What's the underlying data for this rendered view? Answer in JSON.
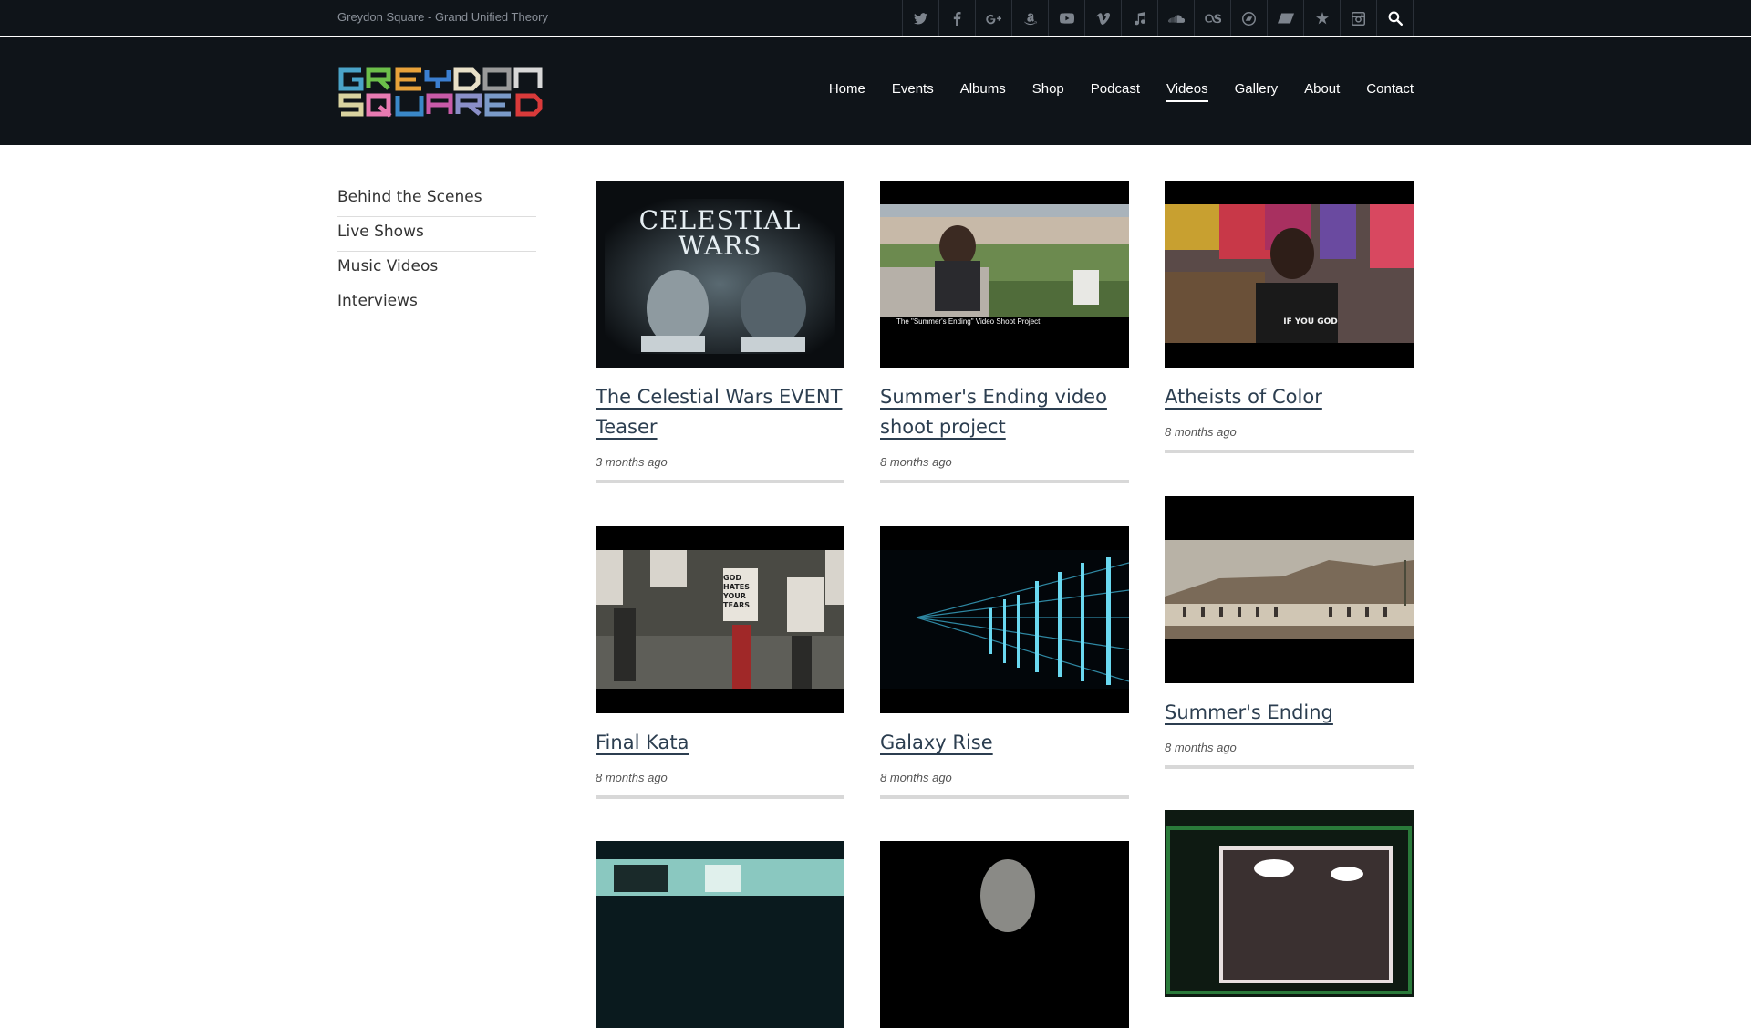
{
  "topbar": {
    "tagline": "Greydon Square - Grand Unified Theory",
    "social_icons": [
      "twitter-icon",
      "facebook-icon",
      "google-plus-icon",
      "amazon-icon",
      "youtube-icon",
      "vimeo-icon",
      "itunes-icon",
      "soundcloud-icon",
      "lastfm-icon",
      "bandcamp-icon",
      "myspace-icon",
      "reverbnation-icon",
      "instagram-icon",
      "search-icon"
    ]
  },
  "header": {
    "logo_text": "GREYDON SQUARED",
    "nav": [
      "Home",
      "Events",
      "Albums",
      "Shop",
      "Podcast",
      "Videos",
      "Gallery",
      "About",
      "Contact"
    ],
    "active_nav": "Videos"
  },
  "sidebar": {
    "categories": [
      "Behind the Scenes",
      "Live Shows",
      "Music Videos",
      "Interviews"
    ]
  },
  "videos": [
    {
      "title": "The Celestial Wars EVENT Teaser",
      "date": "3 months ago",
      "thumb_text": "CELESTIAL WARS"
    },
    {
      "title": "Summer's Ending video shoot project",
      "date": "8 months ago",
      "thumb_text": "The \"Summer's Ending\" Video Shoot Project"
    },
    {
      "title": "Atheists of Color",
      "date": "8 months ago",
      "thumb_text": "IF YOU GOD"
    },
    {
      "title": "Final Kata",
      "date": "8 months ago",
      "thumb_text": "GOD HATES YOUR TEARS"
    },
    {
      "title": "Galaxy Rise",
      "date": "8 months ago",
      "thumb_text": ""
    },
    {
      "title": "Summer's Ending",
      "date": "8 months ago",
      "thumb_text": ""
    }
  ],
  "colors": {
    "header_bg": "#0f1419",
    "link": "#2c3e50",
    "rule": "#d8d8d8"
  }
}
